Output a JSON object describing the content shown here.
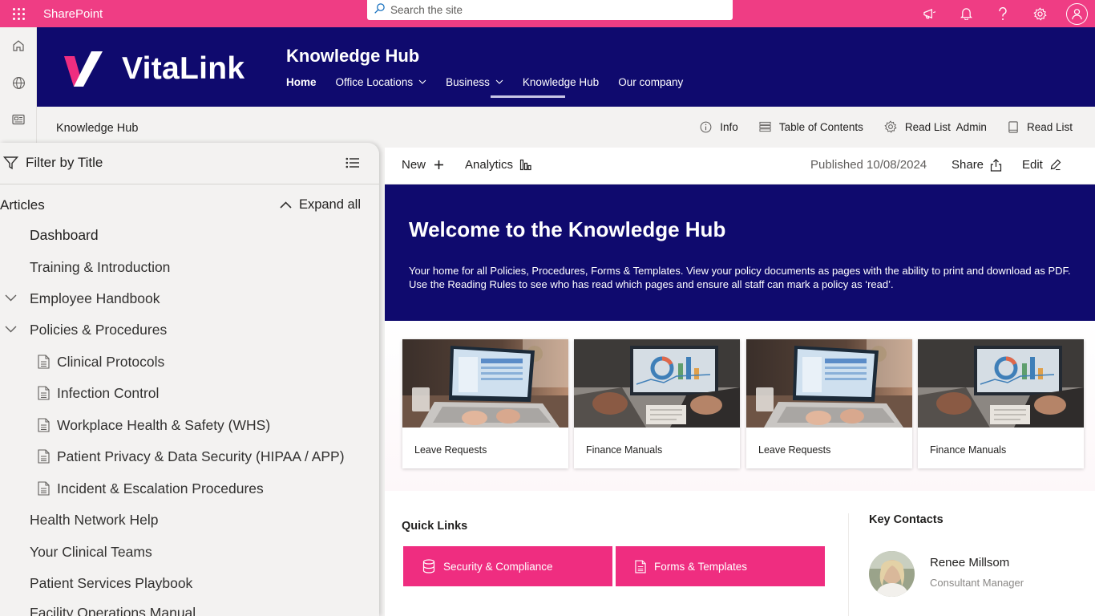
{
  "suite": {
    "app_name": "SharePoint",
    "search_placeholder": "Search the site"
  },
  "hub": {
    "logo_text": "VitaLink",
    "title": "Knowledge Hub",
    "nav": [
      {
        "label": "Home",
        "has_menu": false
      },
      {
        "label": "Office Locations",
        "has_menu": true
      },
      {
        "label": "Business",
        "has_menu": true
      },
      {
        "label": "Knowledge Hub",
        "has_menu": false,
        "selected": true
      },
      {
        "label": "Our company",
        "has_menu": false
      }
    ]
  },
  "command_bar": {
    "page_name": "Knowledge Hub",
    "actions": [
      {
        "label": "Info",
        "icon": "info-icon"
      },
      {
        "label": "Table of Contents",
        "icon": "table-of-contents-icon"
      },
      {
        "label": "Read List  Admin",
        "icon": "settings-icon"
      },
      {
        "label": "Read List",
        "icon": "book-icon"
      }
    ]
  },
  "left_nav": {
    "filter_label": "Filter by Title",
    "section_label": "Articles",
    "expand_label": "Expand all",
    "items": [
      {
        "label": "Dashboard",
        "level": 1,
        "type": "page"
      },
      {
        "label": "Training & Introduction",
        "level": 1,
        "type": "page"
      },
      {
        "label": "Employee Handbook",
        "level": 1,
        "type": "folder",
        "expanded": true
      },
      {
        "label": "Policies & Procedures",
        "level": 1,
        "type": "folder",
        "expanded": true
      },
      {
        "label": "Clinical Protocols",
        "level": 2,
        "type": "document"
      },
      {
        "label": "Infection Control",
        "level": 2,
        "type": "document"
      },
      {
        "label": "Workplace Health & Safety (WHS)",
        "level": 2,
        "type": "document"
      },
      {
        "label": "Patient Privacy & Data Security (HIPAA / APP)",
        "level": 2,
        "type": "document"
      },
      {
        "label": "Incident & Escalation Procedures",
        "level": 2,
        "type": "document"
      },
      {
        "label": "Health Network Help",
        "level": 1,
        "type": "page"
      },
      {
        "label": "Your Clinical Teams",
        "level": 1,
        "type": "page"
      },
      {
        "label": "Patient Services Playbook",
        "level": 1,
        "type": "page"
      },
      {
        "label": "Facility Operations Manual",
        "level": 1,
        "type": "page"
      }
    ]
  },
  "toolbar": {
    "new_label": "New",
    "analytics_label": "Analytics",
    "published": "Published 10/08/2024",
    "share_label": "Share",
    "edit_label": "Edit"
  },
  "hero": {
    "title": "Welcome to the Knowledge Hub",
    "description": "Your home for all Policies, Procedures, Forms & Templates. View your policy documents as pages with the ability to print and download as PDF. Use the Reading Rules to see who has read which pages and ensure all staff can mark a policy as ‘read’."
  },
  "cards": [
    {
      "label": "Leave Requests",
      "image": "laptop-photo"
    },
    {
      "label": "Finance Manuals",
      "image": "finance-photo"
    },
    {
      "label": "Leave Requests",
      "image": "laptop-photo"
    },
    {
      "label": "Finance Manuals",
      "image": "finance-photo"
    }
  ],
  "quick_links": {
    "title": "Quick Links",
    "links": [
      {
        "label": "Security & Compliance",
        "icon": "database-icon"
      },
      {
        "label": "Forms & Templates",
        "icon": "document-icon"
      }
    ]
  },
  "key_contacts": {
    "title": "Key Contacts",
    "contacts": [
      {
        "name": "Renee Millsom",
        "role": "Consultant Manager"
      }
    ]
  },
  "colors": {
    "suite_bar": "#ef3d84",
    "hub_header": "#0f0a6e",
    "quick_link": "#ef2d80",
    "logo_accent": "#ef2d80"
  }
}
